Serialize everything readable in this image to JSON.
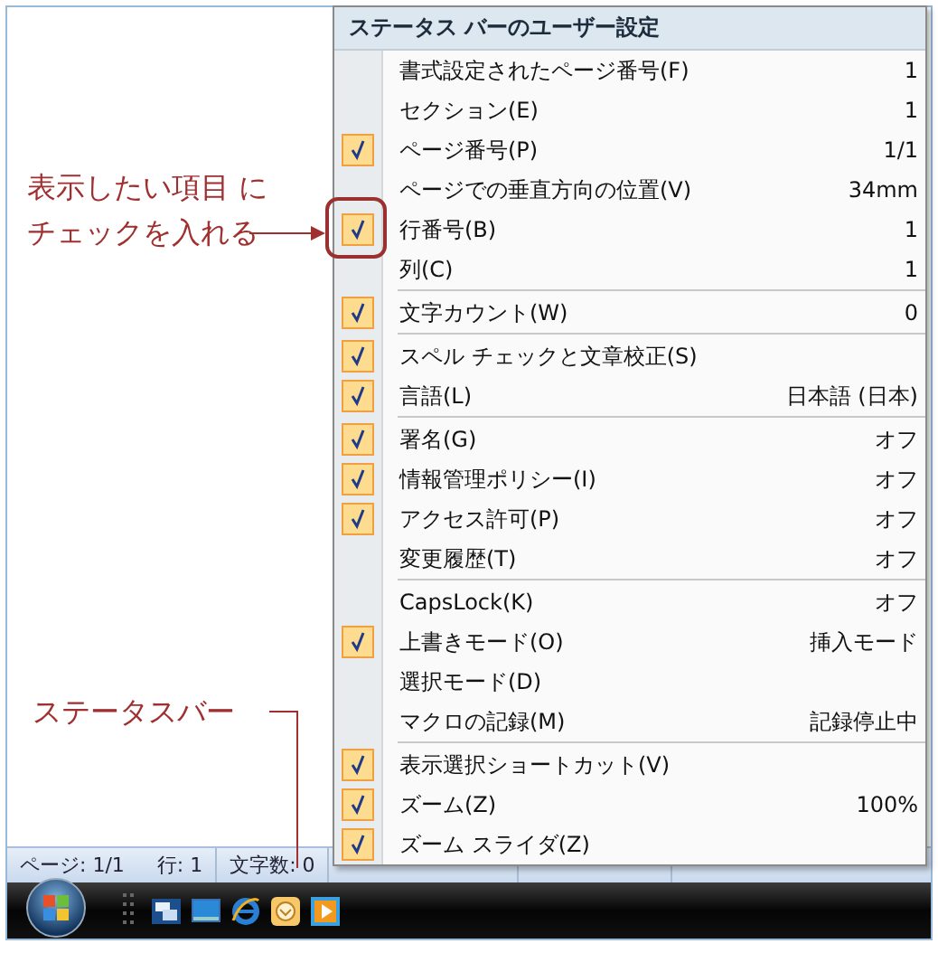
{
  "menu": {
    "title": "ステータス バーのユーザー設定",
    "groups": [
      {
        "items": [
          {
            "label": "書式設定されたページ番号(F)",
            "value": "1",
            "checked": false
          },
          {
            "label": "セクション(E)",
            "value": "1",
            "checked": false
          },
          {
            "label": "ページ番号(P)",
            "value": "1/1",
            "checked": true
          },
          {
            "label": "ページでの垂直方向の位置(V)",
            "value": "34mm",
            "checked": false
          },
          {
            "label": "行番号(B)",
            "value": "1",
            "checked": true
          },
          {
            "label": "列(C)",
            "value": "1",
            "checked": false
          }
        ]
      },
      {
        "items": [
          {
            "label": "文字カウント(W)",
            "value": "0",
            "checked": true
          }
        ]
      },
      {
        "items": [
          {
            "label": "スペル チェックと文章校正(S)",
            "checked": true
          },
          {
            "label": "言語(L)",
            "value": "日本語 (日本)",
            "checked": true
          }
        ]
      },
      {
        "items": [
          {
            "label": "署名(G)",
            "value": "オフ",
            "checked": true
          },
          {
            "label": "情報管理ポリシー(I)",
            "value": "オフ",
            "checked": true
          },
          {
            "label": "アクセス許可(P)",
            "value": "オフ",
            "checked": true
          },
          {
            "label": "変更履歴(T)",
            "value": "オフ",
            "checked": false
          }
        ]
      },
      {
        "items": [
          {
            "label": "CapsLock(K)",
            "value": "オフ",
            "checked": false
          },
          {
            "label": "上書きモード(O)",
            "value": "挿入モード",
            "checked": true
          },
          {
            "label": "選択モード(D)",
            "checked": false
          },
          {
            "label": "マクロの記録(M)",
            "value": "記録停止中",
            "checked": false
          }
        ]
      },
      {
        "items": [
          {
            "label": "表示選択ショートカット(V)",
            "checked": true
          },
          {
            "label": "ズーム(Z)",
            "value": "100%",
            "checked": true
          },
          {
            "label": "ズーム スライダ(Z)",
            "checked": true
          }
        ]
      }
    ]
  },
  "annotations": {
    "check_note": [
      "表示したい項目 に",
      "チェックを入れる"
    ],
    "status_note": "ステータスバー"
  },
  "status_bar": [
    [
      "ページ: 1/1",
      "行: 1"
    ],
    [
      "文字数: 0"
    ]
  ]
}
